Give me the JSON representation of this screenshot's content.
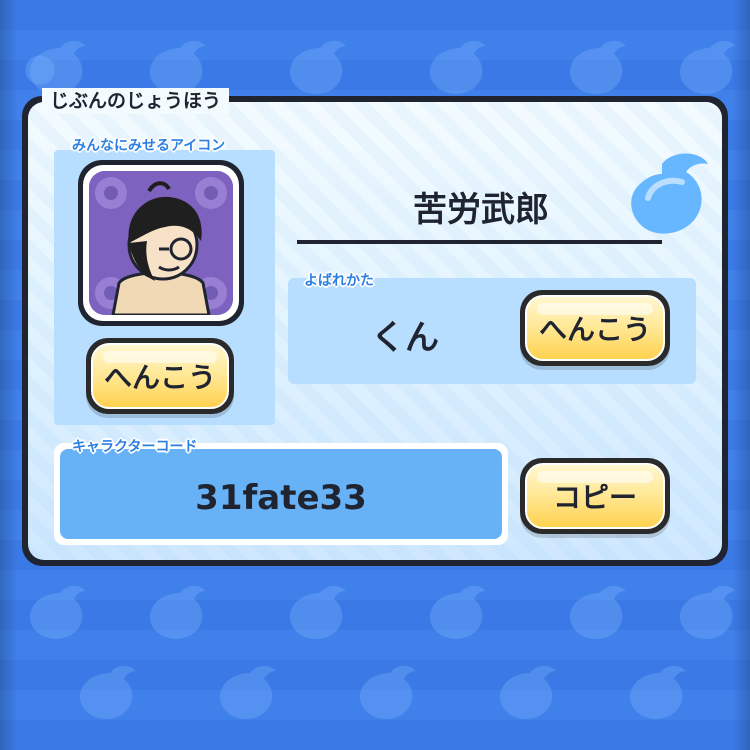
{
  "panel": {
    "title": "じぶんのじょうほう"
  },
  "icon_section": {
    "label": "みんなにみせるアイコン",
    "change_button": "へんこう"
  },
  "player": {
    "name": "苦労武郎"
  },
  "honorific_section": {
    "label": "よばれかた",
    "value": "くん",
    "change_button": "へんこう"
  },
  "character_code": {
    "label": "キャラクターコード",
    "value": "31fate33",
    "copy_button": "コピー"
  },
  "icons": {
    "background_pattern": "spirit-gourd-icon",
    "decoration": "spirit-gourd-icon",
    "avatar": "character-avatar-icon"
  },
  "colors": {
    "background_blue": "#3f7fe6",
    "panel_light_blue": "#e3f4ff",
    "section_blue": "#b7ddff",
    "code_blue": "#67b2f6",
    "button_yellow": "#ffd24f",
    "label_blue": "#2c7fe2",
    "dark_outline": "#1f2430"
  }
}
